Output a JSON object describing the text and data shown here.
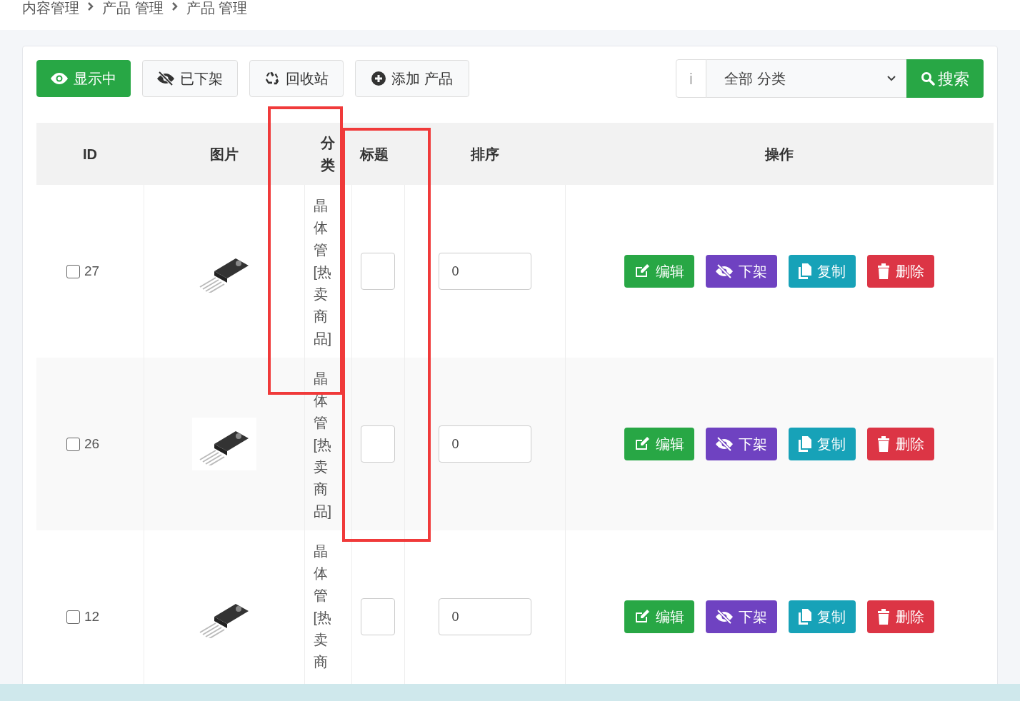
{
  "breadcrumb": [
    "内容管理",
    "产品 管理",
    "产品 管理"
  ],
  "filters": [
    {
      "label": "显示中",
      "selected": true,
      "kind": "shown"
    },
    {
      "label": "已下架",
      "selected": false,
      "kind": "hidden"
    },
    {
      "label": "回收站",
      "selected": false,
      "kind": "trash"
    }
  ],
  "add_button": "添加 产品",
  "search": {
    "prefix": "i",
    "category": "全部 分类",
    "button": "搜索"
  },
  "table": {
    "columns": [
      "ID",
      "图片",
      "分类",
      "标题",
      "排序",
      "操作"
    ],
    "rows": [
      {
        "id": "27",
        "checked": false,
        "category": "晶体管[热卖商品]",
        "sort": "0",
        "actions": [
          {
            "kind": "edit",
            "label": "编辑"
          },
          {
            "kind": "hide",
            "label": "下架"
          },
          {
            "kind": "copy",
            "label": "复制"
          },
          {
            "kind": "delete",
            "label": "删除"
          }
        ]
      },
      {
        "id": "26",
        "checked": false,
        "category": "晶体管[热卖商品]",
        "sort": "0",
        "actions": [
          {
            "kind": "edit",
            "label": "编辑"
          },
          {
            "kind": "hide",
            "label": "下架"
          },
          {
            "kind": "copy",
            "label": "复制"
          },
          {
            "kind": "delete",
            "label": "删除"
          }
        ]
      },
      {
        "id": "12",
        "checked": false,
        "category": "晶体管[热卖商",
        "sort": "0",
        "actions": [
          {
            "kind": "edit",
            "label": "编辑"
          },
          {
            "kind": "hide",
            "label": "下架"
          },
          {
            "kind": "copy",
            "label": "复制"
          },
          {
            "kind": "delete",
            "label": "删除"
          }
        ]
      }
    ]
  }
}
